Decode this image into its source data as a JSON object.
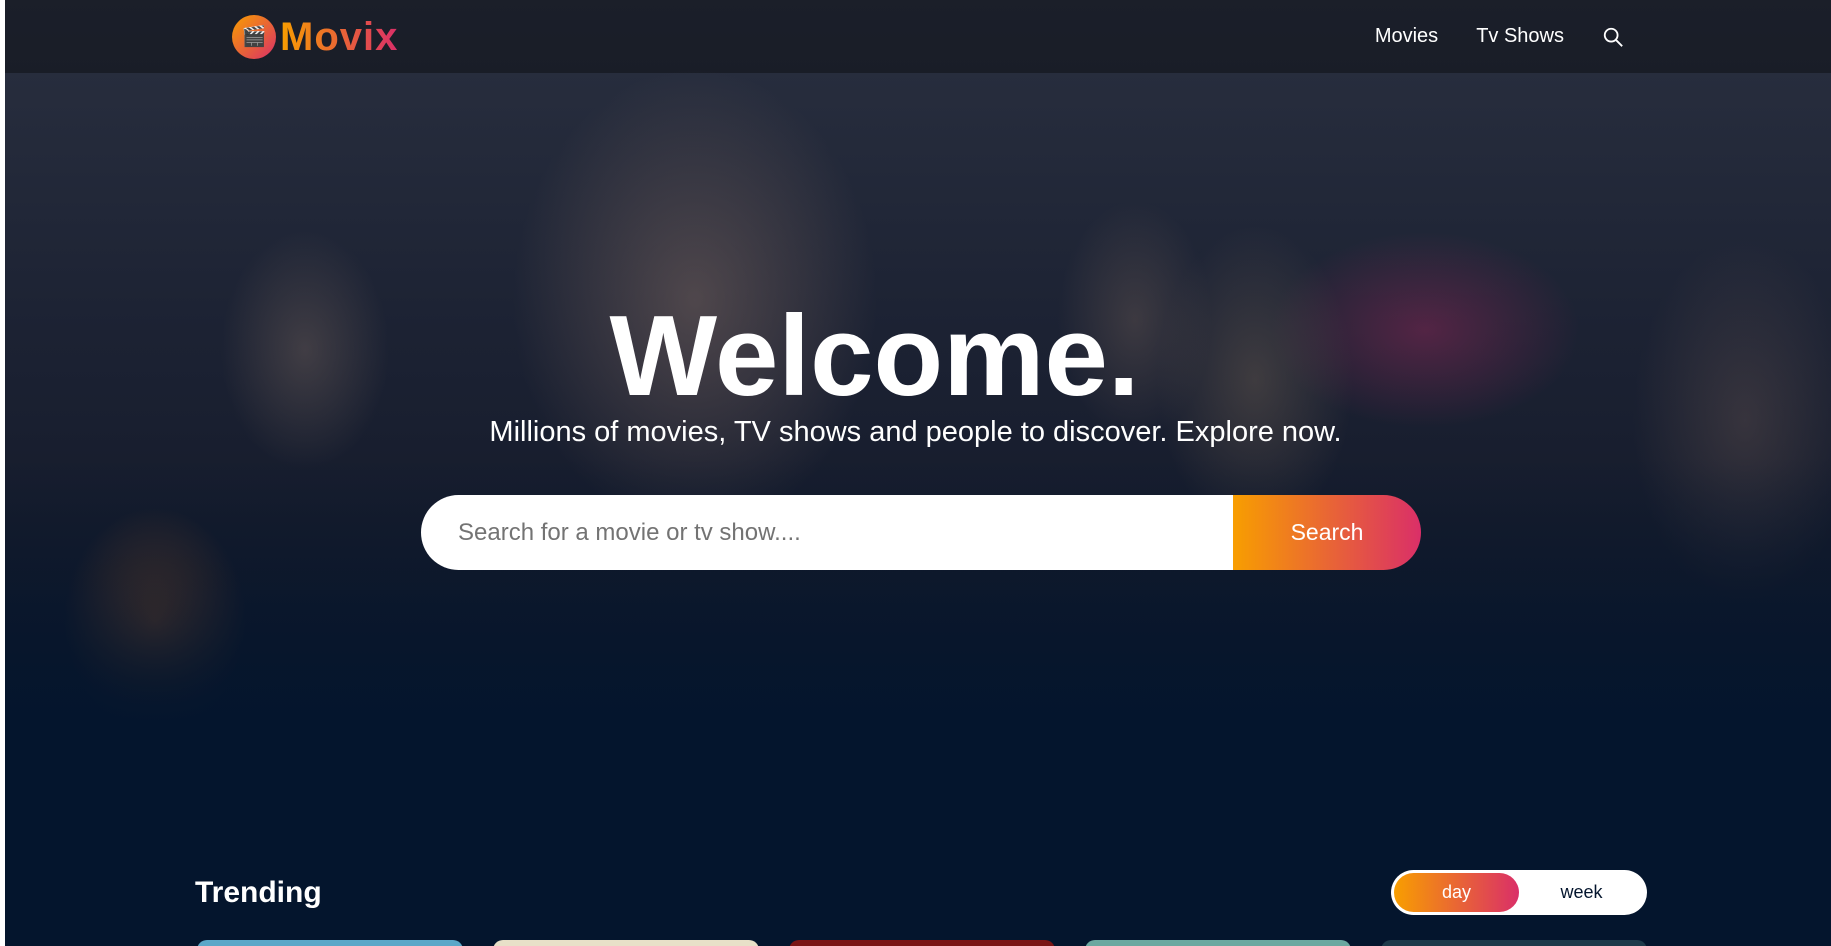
{
  "header": {
    "logo_text": "Movix",
    "logo_icon": "clapperboard-icon",
    "nav": [
      "Movies",
      "Tv Shows"
    ],
    "search_icon": "search-icon"
  },
  "hero": {
    "title": "Welcome.",
    "subtitle": "Millions of movies, TV shows and people to discover. Explore now.",
    "search": {
      "placeholder": "Search for a movie or tv show....",
      "button_label": "Search"
    }
  },
  "trending": {
    "title": "Trending",
    "tabs": [
      {
        "label": "day",
        "active": true
      },
      {
        "label": "week",
        "active": false
      }
    ]
  },
  "colors": {
    "background": "#04152d",
    "accent_gradient_start": "#f89e00",
    "accent_gradient_end": "#da2f68"
  }
}
